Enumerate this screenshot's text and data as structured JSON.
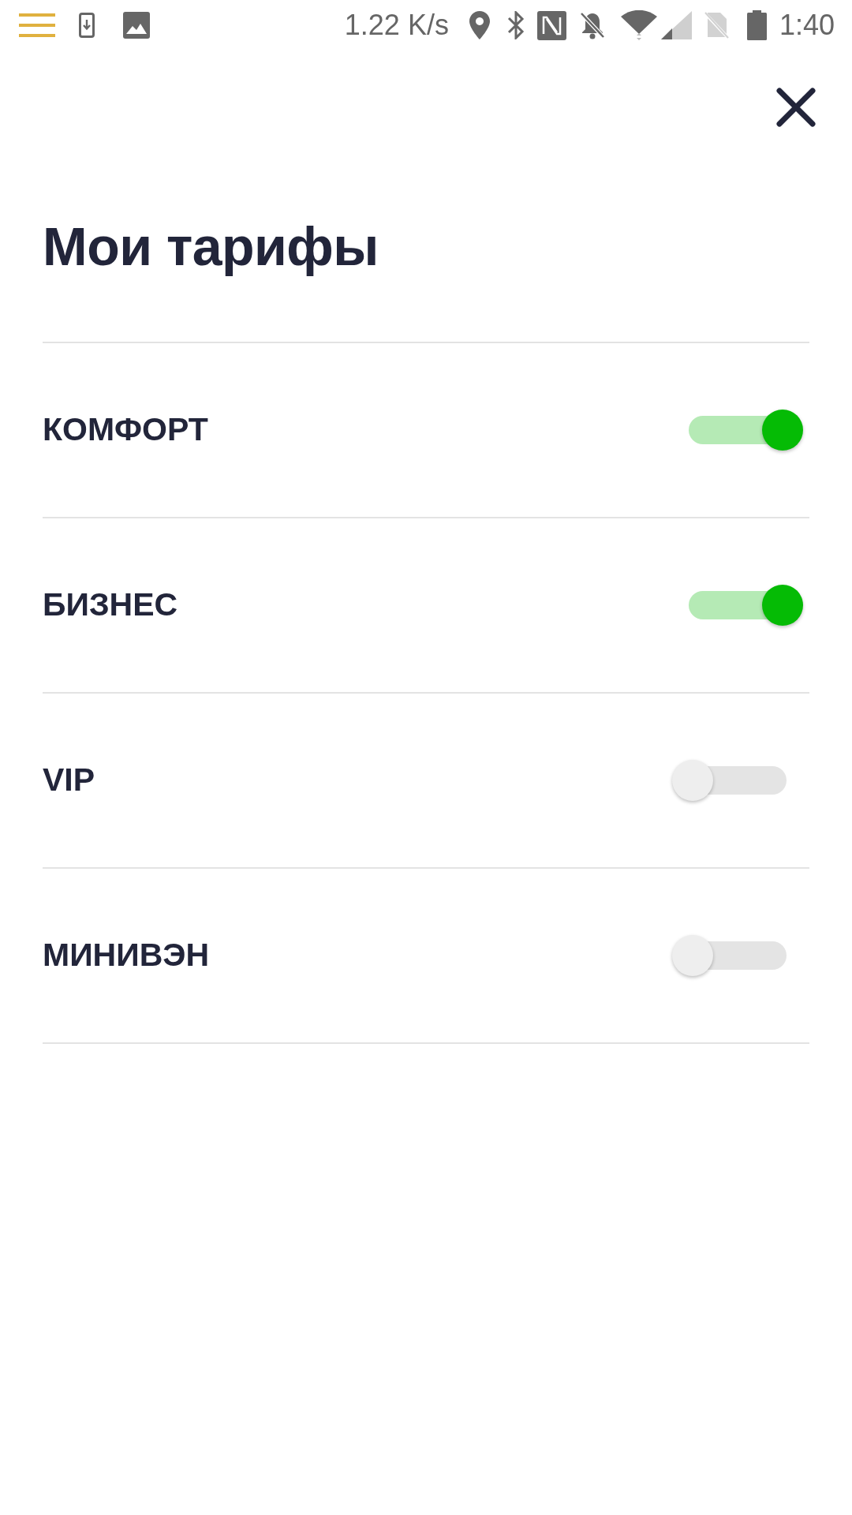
{
  "status_bar": {
    "network_speed": "1.22 K/s",
    "time": "1:40"
  },
  "title": "Мои тарифы",
  "tariffs": [
    {
      "name": "КОМФОРТ",
      "on": true
    },
    {
      "name": "БИЗНЕС",
      "on": true
    },
    {
      "name": "VIP",
      "on": false
    },
    {
      "name": "МИНИВЭН",
      "on": false
    }
  ]
}
